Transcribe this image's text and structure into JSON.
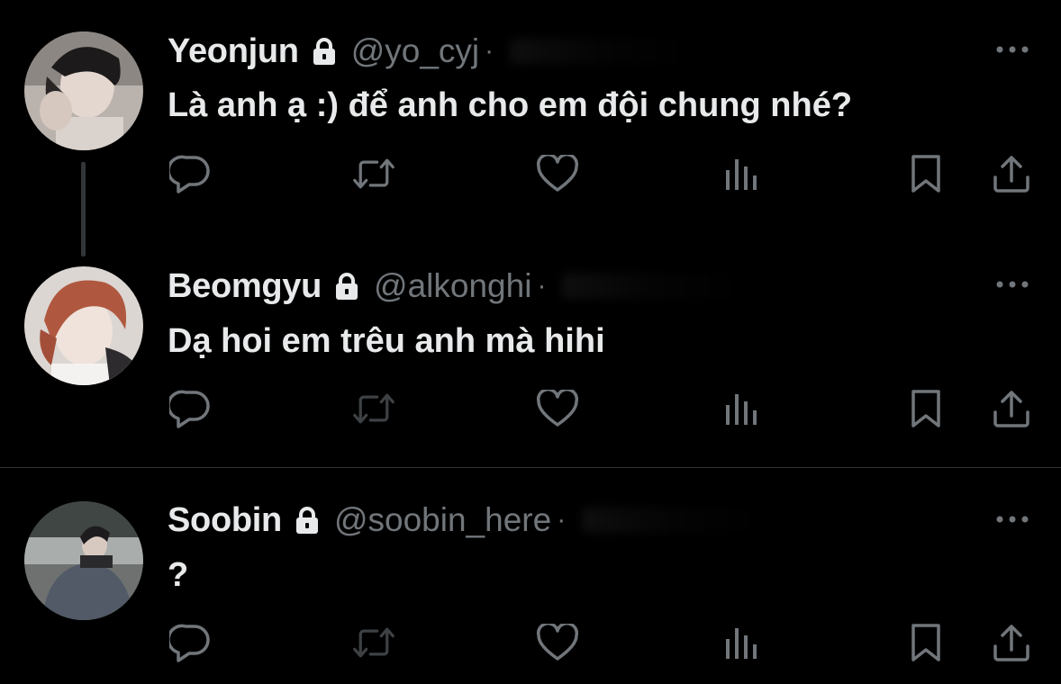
{
  "tweets": [
    {
      "name": "Yeonjun",
      "handle": "@yo_cyj",
      "separator": "·",
      "text": "Là anh ạ :) để anh cho em đội chung nhé?"
    },
    {
      "name": "Beomgyu",
      "handle": "@alkonghi",
      "separator": "·",
      "text": "Dạ hoi em trêu anh mà hihi"
    },
    {
      "name": "Soobin",
      "handle": "@soobin_here",
      "separator": "·",
      "text": "?"
    }
  ],
  "icons": {
    "lock": "lock-icon",
    "more": "more-icon",
    "reply": "reply-icon",
    "retweet": "retweet-icon",
    "like": "heart-icon",
    "views": "views-icon",
    "bookmark": "bookmark-icon",
    "share": "share-icon"
  },
  "colors": {
    "background": "#000000",
    "text": "#e7e9ea",
    "secondary": "#71767b",
    "divider": "#2f3336"
  }
}
